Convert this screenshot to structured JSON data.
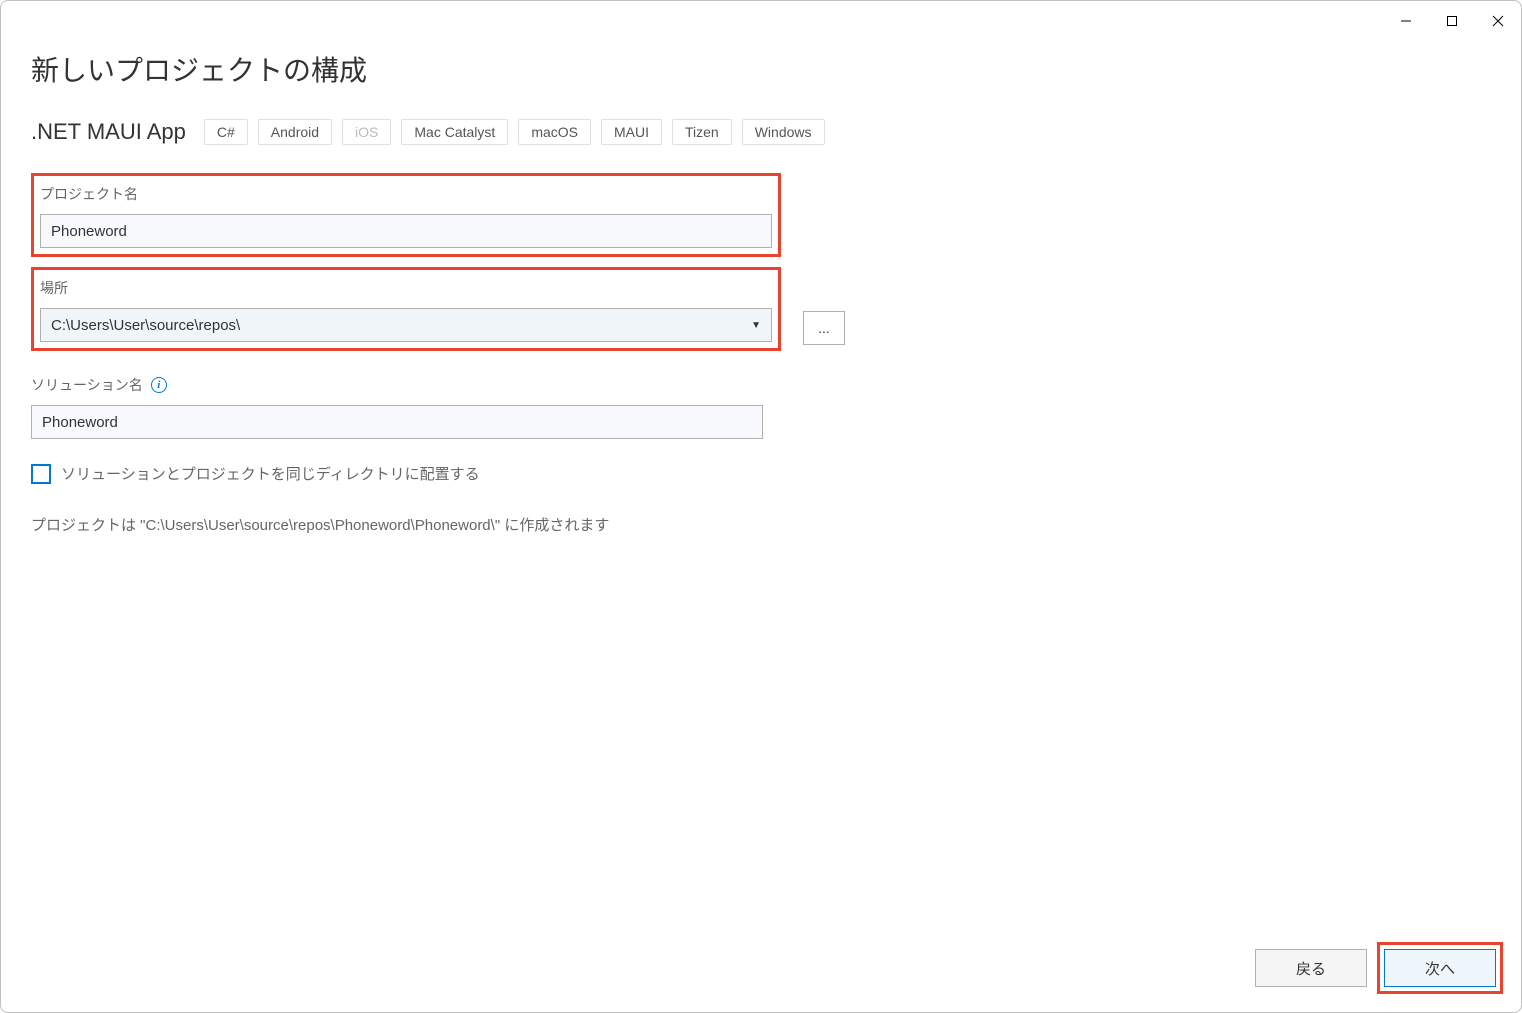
{
  "page_title": "新しいプロジェクトの構成",
  "template_name": ".NET MAUI App",
  "tags": [
    {
      "label": "C#",
      "disabled": false
    },
    {
      "label": "Android",
      "disabled": false
    },
    {
      "label": "iOS",
      "disabled": true
    },
    {
      "label": "Mac Catalyst",
      "disabled": false
    },
    {
      "label": "macOS",
      "disabled": false
    },
    {
      "label": "MAUI",
      "disabled": false
    },
    {
      "label": "Tizen",
      "disabled": false
    },
    {
      "label": "Windows",
      "disabled": false
    }
  ],
  "project_name": {
    "label": "プロジェクト名",
    "value": "Phoneword"
  },
  "location": {
    "label": "場所",
    "value": "C:\\Users\\User\\source\\repos\\",
    "browse_label": "..."
  },
  "solution_name": {
    "label": "ソリューション名",
    "value": "Phoneword"
  },
  "same_directory": {
    "label": "ソリューションとプロジェクトを同じディレクトリに配置する",
    "checked": false
  },
  "creation_path_text": "プロジェクトは \"C:\\Users\\User\\source\\repos\\Phoneword\\Phoneword\\\" に作成されます",
  "footer": {
    "back": "戻る",
    "next": "次へ"
  }
}
